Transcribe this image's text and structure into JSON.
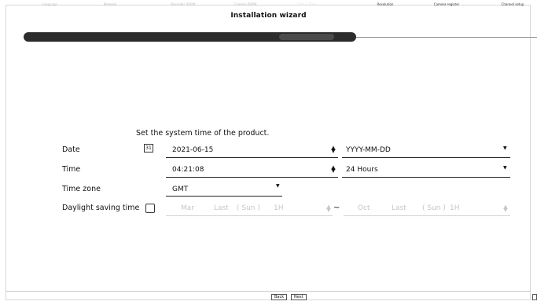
{
  "window": {
    "title": "Installation wizard"
  },
  "steps": [
    {
      "label": "Language",
      "state": "done"
    },
    {
      "label": "Network",
      "state": "done"
    },
    {
      "label": "Recorder ID/PW",
      "state": "done"
    },
    {
      "label": "Camera ID/PW",
      "state": "done"
    },
    {
      "label": "Date & Time",
      "state": "current"
    },
    {
      "label": "Resolution",
      "state": "pending"
    },
    {
      "label": "Camera register",
      "state": "pending"
    },
    {
      "label": "Channel setup",
      "state": "pending"
    }
  ],
  "intro": "Set the system time of the product.",
  "date": {
    "label": "Date",
    "calendar_icon_text": "31",
    "value": "2021-06-15",
    "format": "YYYY-MM-DD"
  },
  "time": {
    "label": "Time",
    "value": "04:21:08",
    "format": "24 Hours"
  },
  "timezone": {
    "label": "Time zone",
    "value": "GMT"
  },
  "dst": {
    "label": "Daylight saving time",
    "checked": false,
    "start": {
      "month": "Mar",
      "week": "Last",
      "day": "( Sun )",
      "hour": "1H"
    },
    "separator": "~",
    "end": {
      "month": "Oct",
      "week": "Last",
      "day": "( Sun )",
      "hour": "1H"
    }
  },
  "footer": {
    "back_label": "Back",
    "next_label": "Next"
  },
  "icons": {
    "updown": "updown-arrow-icon",
    "dropdown": "dropdown-arrow-icon",
    "calendar": "calendar-icon"
  }
}
